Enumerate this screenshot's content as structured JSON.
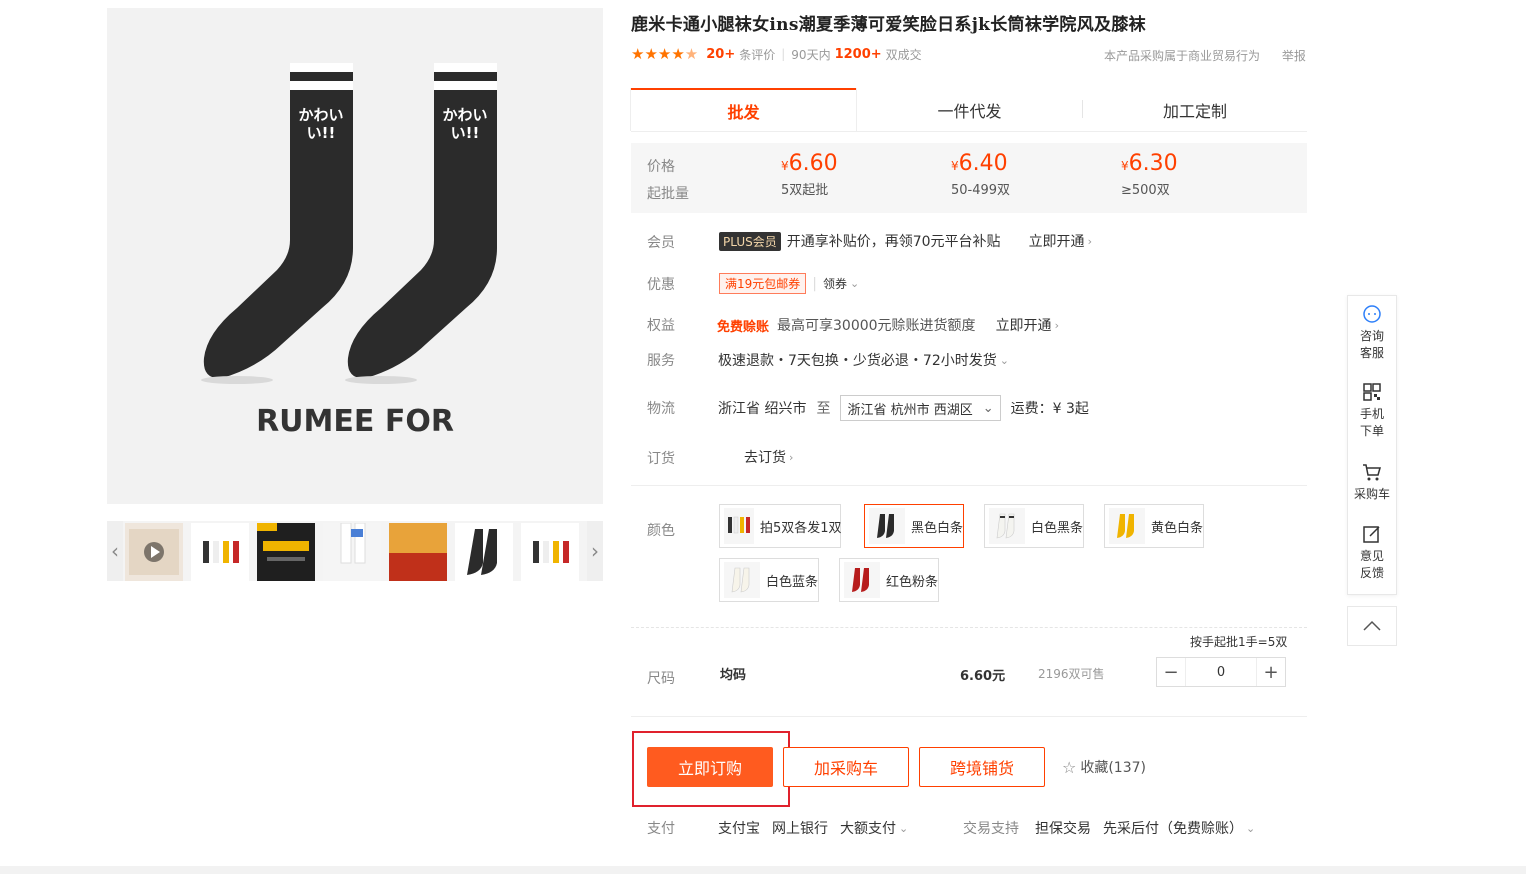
{
  "product": {
    "title": "鹿米卡通小腿袜女ins潮夏季薄可爱笑脸日系jk长筒袜学院风及膝袜",
    "brand_text": "RUMEE FOR",
    "sock_text_1": "かわい",
    "sock_text_2": "い!!"
  },
  "rating": {
    "stars": 4.5,
    "review_count": "20+",
    "review_label": "条评价",
    "period_label": "90天内",
    "sold_count": "1200+",
    "sold_label": "双成交",
    "notice": "本产品采购属于商业贸易行为",
    "report": "举报"
  },
  "tabs": [
    {
      "label": "批发",
      "active": true
    },
    {
      "label": "一件代发",
      "active": false
    },
    {
      "label": "加工定制",
      "active": false
    }
  ],
  "pricing": {
    "price_label": "价格",
    "moq_label": "起批量",
    "currency": "¥",
    "tiers": [
      {
        "price": "6.60",
        "moq": "5双起批"
      },
      {
        "price": "6.40",
        "moq": "50-499双"
      },
      {
        "price": "6.30",
        "moq": "≥500双"
      }
    ]
  },
  "member": {
    "label": "会员",
    "badge": "PLUS会员",
    "text": "开通享补贴价，再领70元平台补贴",
    "link": "立即开通"
  },
  "discount": {
    "label": "优惠",
    "coupon": "满19元包邮券",
    "get": "领券"
  },
  "rights": {
    "label": "权益",
    "highlight": "免费赊账",
    "text": "最高可享30000元赊账进货额度",
    "link": "立即开通"
  },
  "service": {
    "label": "服务",
    "text": "极速退款・7天包换・少货必退・72小时发货"
  },
  "logistics": {
    "label": "物流",
    "from": "浙江省 绍兴市",
    "to_label": "至",
    "to": "浙江省 杭州市 西湖区",
    "freight": "运费：¥ 3起"
  },
  "order": {
    "label": "订货",
    "link": "去订货"
  },
  "colors": {
    "label": "颜色",
    "options": [
      {
        "name": "拍5双各发1双",
        "selected": false
      },
      {
        "name": "黑色白条",
        "selected": true
      },
      {
        "name": "白色黑条",
        "selected": false
      },
      {
        "name": "黄色白条",
        "selected": false
      },
      {
        "name": "白色蓝条",
        "selected": false
      },
      {
        "name": "红色粉条",
        "selected": false
      }
    ]
  },
  "size": {
    "note": "按手起批1手=5双",
    "label": "尺码",
    "name": "均码",
    "price": "6.60元",
    "stock": "2196双可售",
    "minus": "−",
    "quantity": "0",
    "plus": "+"
  },
  "actions": {
    "buy": "立即订购",
    "cart": "加采购车",
    "cross": "跨境铺货",
    "fav": "收藏(137)"
  },
  "payment": {
    "label": "支付",
    "methods": [
      "支付宝",
      "网上银行",
      "大额支付"
    ],
    "support_label": "交易支持",
    "support": [
      "担保交易",
      "先采后付（免费赊账）"
    ]
  },
  "sidebar": {
    "items": [
      {
        "label1": "咨询",
        "label2": "客服"
      },
      {
        "label1": "手机",
        "label2": "下单"
      },
      {
        "label1": "采购车",
        "label2": ""
      },
      {
        "label1": "意见",
        "label2": "反馈"
      }
    ]
  },
  "colors_hex": {
    "accent": "#ff4000",
    "button": "#ff5b1f",
    "highlight_box": "#e0212d"
  }
}
